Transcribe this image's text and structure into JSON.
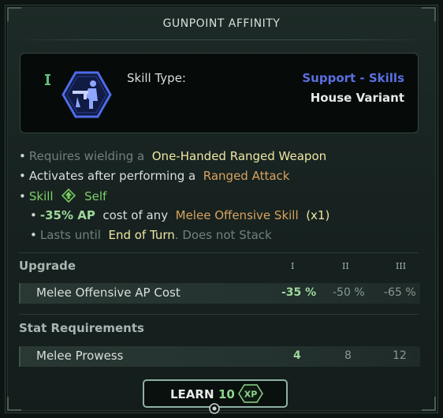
{
  "title": "GUNPOINT AFFINITY",
  "skill": {
    "rank": "I",
    "type_label": "Skill Type:",
    "category": "Support - Skills",
    "variant": "House Variant",
    "icon": "gunpoint-affinity-icon"
  },
  "description": {
    "line1": {
      "a": "Requires wielding a",
      "b": "One-Handed Ranged Weapon"
    },
    "line2": {
      "a": "Activates after performing a",
      "b": "Ranged Attack"
    },
    "line3": {
      "a": "Skill",
      "icon": "self-target-icon",
      "b": "Self"
    },
    "line4": {
      "a": "-35% AP",
      "b": "cost of any",
      "c": "Melee Offensive Skill",
      "d": "(x1)"
    },
    "line5": {
      "a": "Lasts until",
      "b": "End of Turn",
      "c": ". Does not Stack"
    }
  },
  "upgrade": {
    "heading": "Upgrade",
    "levels": [
      "I",
      "II",
      "III"
    ],
    "row": {
      "label": "Melee Offensive AP Cost",
      "values": [
        "-35 %",
        "-50 %",
        "-65 %"
      ]
    }
  },
  "stat_requirements": {
    "heading": "Stat Requirements",
    "row": {
      "label": "Melee Prowess",
      "values": [
        "4",
        "8",
        "12"
      ]
    }
  },
  "learn": {
    "label": "LEARN",
    "cost": "10",
    "currency": "XP"
  },
  "colors": {
    "accent_blue": "#5b6fe0",
    "highlight_yellow": "#efe6a2",
    "highlight_orange": "#d9a25e",
    "positive_green": "#7fcf6a"
  }
}
